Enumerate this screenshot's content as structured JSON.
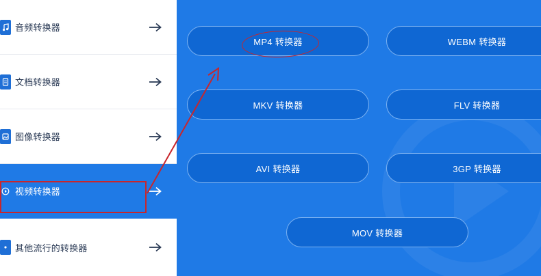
{
  "sidebar": {
    "items": [
      {
        "label": "音频转换器",
        "icon": "music-note-icon",
        "active": false
      },
      {
        "label": "文档转换器",
        "icon": "document-icon",
        "active": false
      },
      {
        "label": "图像转换器",
        "icon": "image-icon",
        "active": false
      },
      {
        "label": "视频转换器",
        "icon": "play-circle-icon",
        "active": true
      },
      {
        "label": "其他流行的转换器",
        "icon": "more-dots-icon",
        "active": false
      }
    ]
  },
  "converters": {
    "mp4": "MP4 转换器",
    "webm": "WEBM 转换器",
    "mkv": "MKV 转换器",
    "flv": "FLV 转换器",
    "avi": "AVI 转换器",
    "3gp": "3GP 转换器",
    "mov": "MOV 转换器"
  },
  "colors": {
    "accent": "#1f7ae6",
    "button": "#0f67d3",
    "annotation": "#c8262c",
    "sidebar_text": "#2a3a55"
  }
}
